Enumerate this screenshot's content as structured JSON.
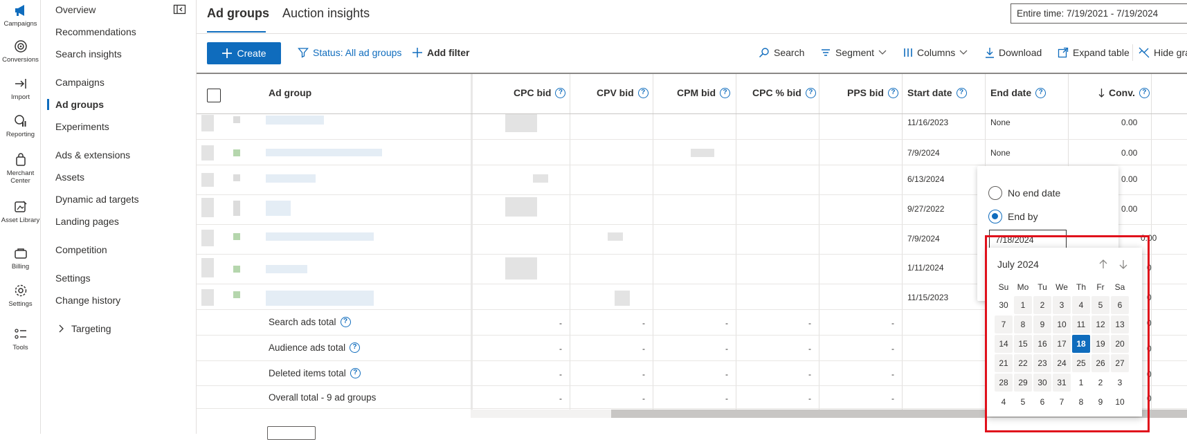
{
  "rail": [
    {
      "label": "Campaigns",
      "icon": "megaphone-icon"
    },
    {
      "label": "Conversions",
      "icon": "target-icon"
    },
    {
      "label": "Import",
      "icon": "import-icon"
    },
    {
      "label": "Reporting",
      "icon": "reporting-icon"
    },
    {
      "label": "Merchant Center",
      "icon": "shopping-bag-icon"
    },
    {
      "label": "Asset Library",
      "icon": "asset-library-icon"
    },
    {
      "label": "Billing",
      "icon": "billing-icon"
    },
    {
      "label": "Settings",
      "icon": "gear-icon"
    },
    {
      "label": "Tools",
      "icon": "tools-icon"
    }
  ],
  "nav": {
    "items": [
      "Overview",
      "Recommendations",
      "Search insights",
      "Campaigns",
      "Ad groups",
      "Experiments",
      "Ads & extensions",
      "Assets",
      "Dynamic ad targets",
      "Landing pages",
      "Competition",
      "Settings",
      "Change history",
      "Targeting"
    ],
    "active": "Ad groups"
  },
  "tabs": {
    "ad_groups": "Ad groups",
    "auction_insights": "Auction insights"
  },
  "date_range": "Entire time: 7/19/2021 - 7/19/2024",
  "toolbar": {
    "create": "Create",
    "status_filter": "Status: All ad groups",
    "add_filter": "Add filter",
    "search": "Search",
    "segment": "Segment",
    "columns": "Columns",
    "download": "Download",
    "expand_table": "Expand table",
    "hide_graph": "Hide gra"
  },
  "table": {
    "headers": {
      "ad_group": "Ad group",
      "cpc_bid": "CPC bid",
      "cpv_bid": "CPV bid",
      "cpm_bid": "CPM bid",
      "cpc_pct_bid": "CPC % bid",
      "pps_bid": "PPS bid",
      "start_date": "Start date",
      "end_date": "End date",
      "conv": "Conv."
    },
    "rows": [
      {
        "start": "11/16/2023",
        "end": "None",
        "conv": "0.00"
      },
      {
        "start": "7/9/2024",
        "end": "None",
        "conv": "0.00"
      },
      {
        "start": "6/13/2024",
        "end": "",
        "conv": "0.00"
      },
      {
        "start": "9/27/2022",
        "end": "",
        "conv": "0.00"
      },
      {
        "start": "7/9/2024",
        "end": "",
        "conv": "0.00"
      },
      {
        "start": "1/11/2024",
        "end": "",
        "conv": "0"
      },
      {
        "start": "11/15/2023",
        "end": "",
        "conv": "0"
      }
    ],
    "totals": [
      {
        "label": "Search ads total",
        "help": true,
        "conv": "0"
      },
      {
        "label": "Audience ads total",
        "help": true,
        "conv": "0"
      },
      {
        "label": "Deleted items total",
        "help": true,
        "conv": "0"
      },
      {
        "label": "Overall total - 9 ad groups",
        "help": false,
        "conv": "0"
      }
    ],
    "dash": "-"
  },
  "end_date_popup": {
    "no_end_date": "No end date",
    "end_by": "End by",
    "selected_option": "End by",
    "input_value": "7/18/2024"
  },
  "calendar": {
    "month": "July 2024",
    "weekdays": [
      "Su",
      "Mo",
      "Tu",
      "We",
      "Th",
      "Fr",
      "Sa"
    ],
    "weeks": [
      [
        "30",
        "1",
        "2",
        "3",
        "4",
        "5",
        "6"
      ],
      [
        "7",
        "8",
        "9",
        "10",
        "11",
        "12",
        "13"
      ],
      [
        "14",
        "15",
        "16",
        "17",
        "18",
        "19",
        "20"
      ],
      [
        "21",
        "22",
        "23",
        "24",
        "25",
        "26",
        "27"
      ],
      [
        "28",
        "29",
        "30",
        "31",
        "1",
        "2",
        "3"
      ],
      [
        "4",
        "5",
        "6",
        "7",
        "8",
        "9",
        "10"
      ]
    ],
    "selected": "18",
    "accent": "#0f6cbd"
  },
  "colors": {
    "accent": "#0f6cbd",
    "highlight_box": "#e0101b"
  }
}
